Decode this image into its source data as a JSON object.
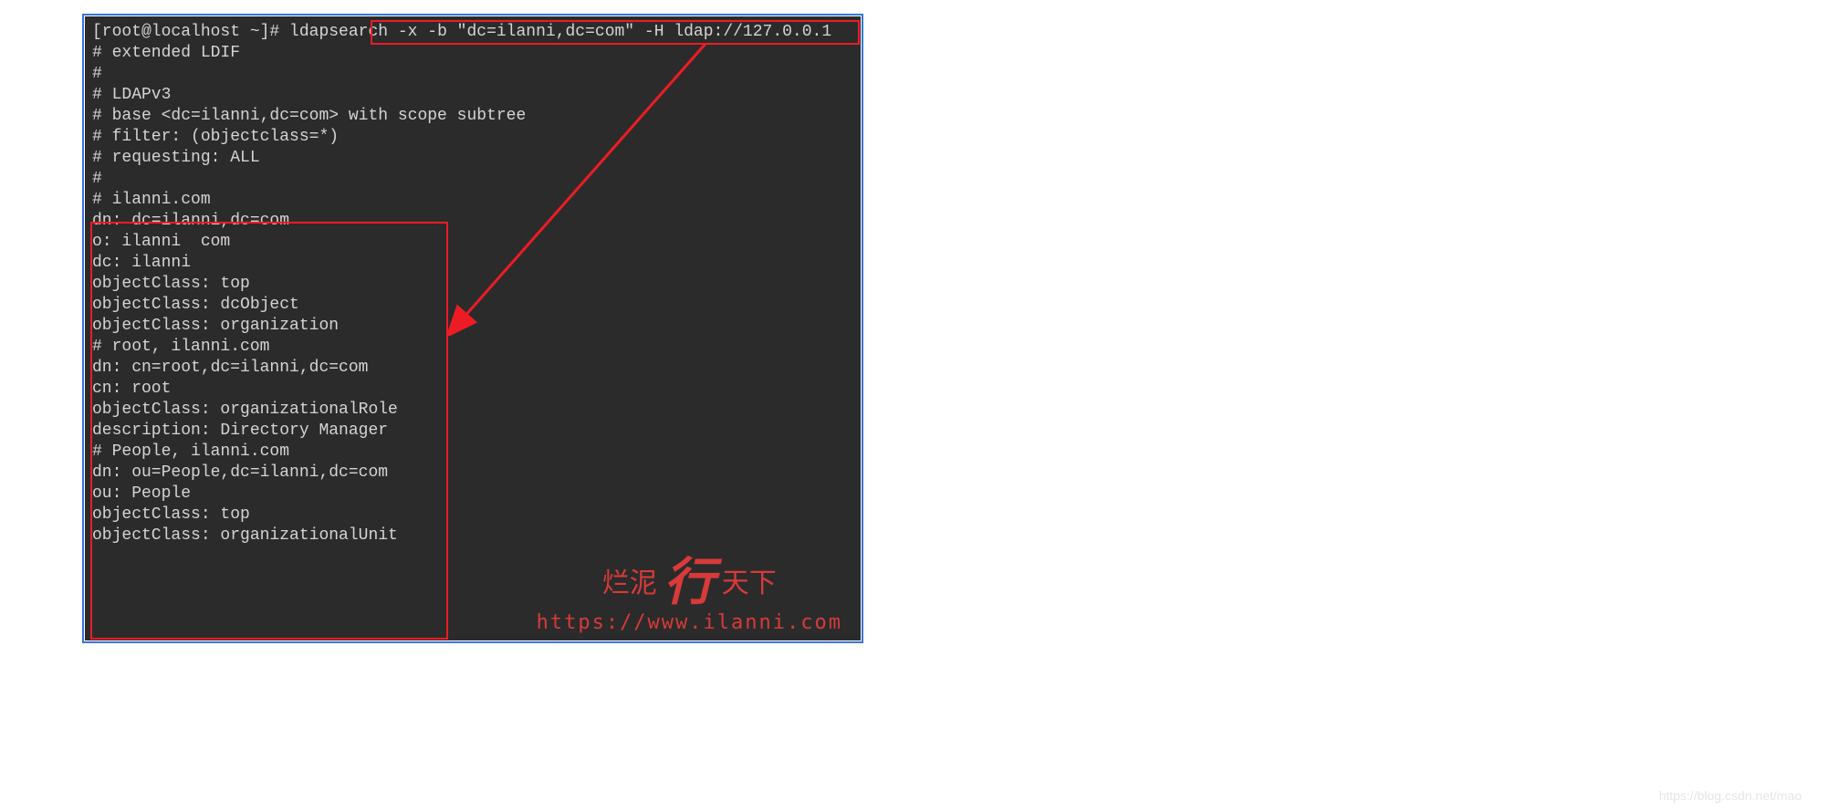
{
  "terminal": {
    "prompt": "[root@localhost ~]# ",
    "command": "ldapsearch -x -b \"dc=ilanni,dc=com\" -H ldap://127.0.0.1",
    "header_lines": [
      "# extended LDIF",
      "#",
      "# LDAPv3",
      "# base <dc=ilanni,dc=com> with scope subtree",
      "# filter: (objectclass=*)",
      "# requesting: ALL",
      "#",
      ""
    ],
    "result_lines": [
      "# ilanni.com",
      "dn: dc=ilanni,dc=com",
      "o: ilanni  com",
      "dc: ilanni",
      "objectClass: top",
      "objectClass: dcObject",
      "objectClass: organization",
      "",
      "# root, ilanni.com",
      "dn: cn=root,dc=ilanni,dc=com",
      "cn: root",
      "objectClass: organizationalRole",
      "description: Directory Manager",
      "",
      "# People, ilanni.com",
      "dn: ou=People,dc=ilanni,dc=com",
      "ou: People",
      "objectClass: top",
      "objectClass: organizationalUnit"
    ]
  },
  "watermark": {
    "text_left": "烂泥",
    "text_center": "行",
    "text_right": "天下",
    "url": "https://www.ilanni.com"
  },
  "csdn_credit": "https://blog.csdn.net/mao"
}
